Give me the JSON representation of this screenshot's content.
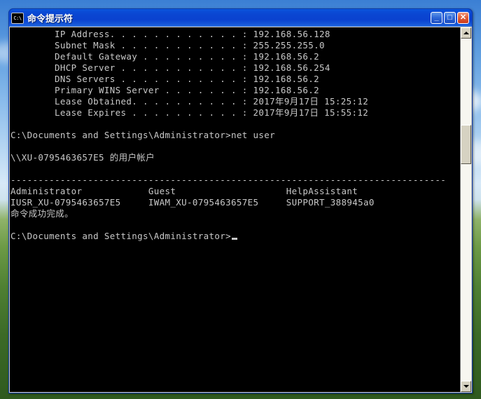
{
  "window": {
    "title": "命令提示符",
    "icon": "console-icon",
    "buttons": {
      "minimize": "_",
      "maximize": "□",
      "close": "✕"
    }
  },
  "console": {
    "lines": [
      "        IP Address. . . . . . . . . . . . : 192.168.56.128",
      "        Subnet Mask . . . . . . . . . . . : 255.255.255.0",
      "        Default Gateway . . . . . . . . . : 192.168.56.2",
      "        DHCP Server . . . . . . . . . . . : 192.168.56.254",
      "        DNS Servers . . . . . . . . . . . : 192.168.56.2",
      "        Primary WINS Server . . . . . . . : 192.168.56.2",
      "        Lease Obtained. . . . . . . . . . : 2017年9月17日 15:25:12",
      "        Lease Expires . . . . . . . . . . : 2017年9月17日 15:55:12",
      "",
      "C:\\Documents and Settings\\Administrator>net user",
      "",
      "\\\\XU-0795463657E5 的用户帐户",
      "",
      "-------------------------------------------------------------------------------",
      "Administrator            Guest                    HelpAssistant",
      "IUSR_XU-0795463657E5     IWAM_XU-0795463657E5     SUPPORT_388945a0",
      "命令成功完成。",
      "",
      "C:\\Documents and Settings\\Administrator>"
    ],
    "prompt": "C:\\Documents and Settings\\Administrator>",
    "cursor_visible": true,
    "ipconfig": {
      "ip_address": "192.168.56.128",
      "subnet_mask": "255.255.255.0",
      "default_gateway": "192.168.56.2",
      "dhcp_server": "192.168.56.254",
      "dns_servers": "192.168.56.2",
      "primary_wins_server": "192.168.56.2",
      "lease_obtained": "2017年9月17日 15:25:12",
      "lease_expires": "2017年9月17日 15:55:12"
    },
    "net_user": {
      "command": "net user",
      "heading": "\\\\XU-0795463657E5 的用户帐户",
      "hostname": "XU-0795463657E5",
      "accounts": [
        [
          "Administrator",
          "Guest",
          "HelpAssistant"
        ],
        [
          "IUSR_XU-0795463657E5",
          "IWAM_XU-0795463657E5",
          "SUPPORT_388945a0"
        ]
      ],
      "status": "命令成功完成。"
    },
    "colors": {
      "background": "#000000",
      "foreground": "#c8c8c8",
      "titlebar": "#0a46d2"
    }
  },
  "scrollbar": {
    "up_arrow": "▲",
    "down_arrow": "▼",
    "orientation": "vertical"
  }
}
